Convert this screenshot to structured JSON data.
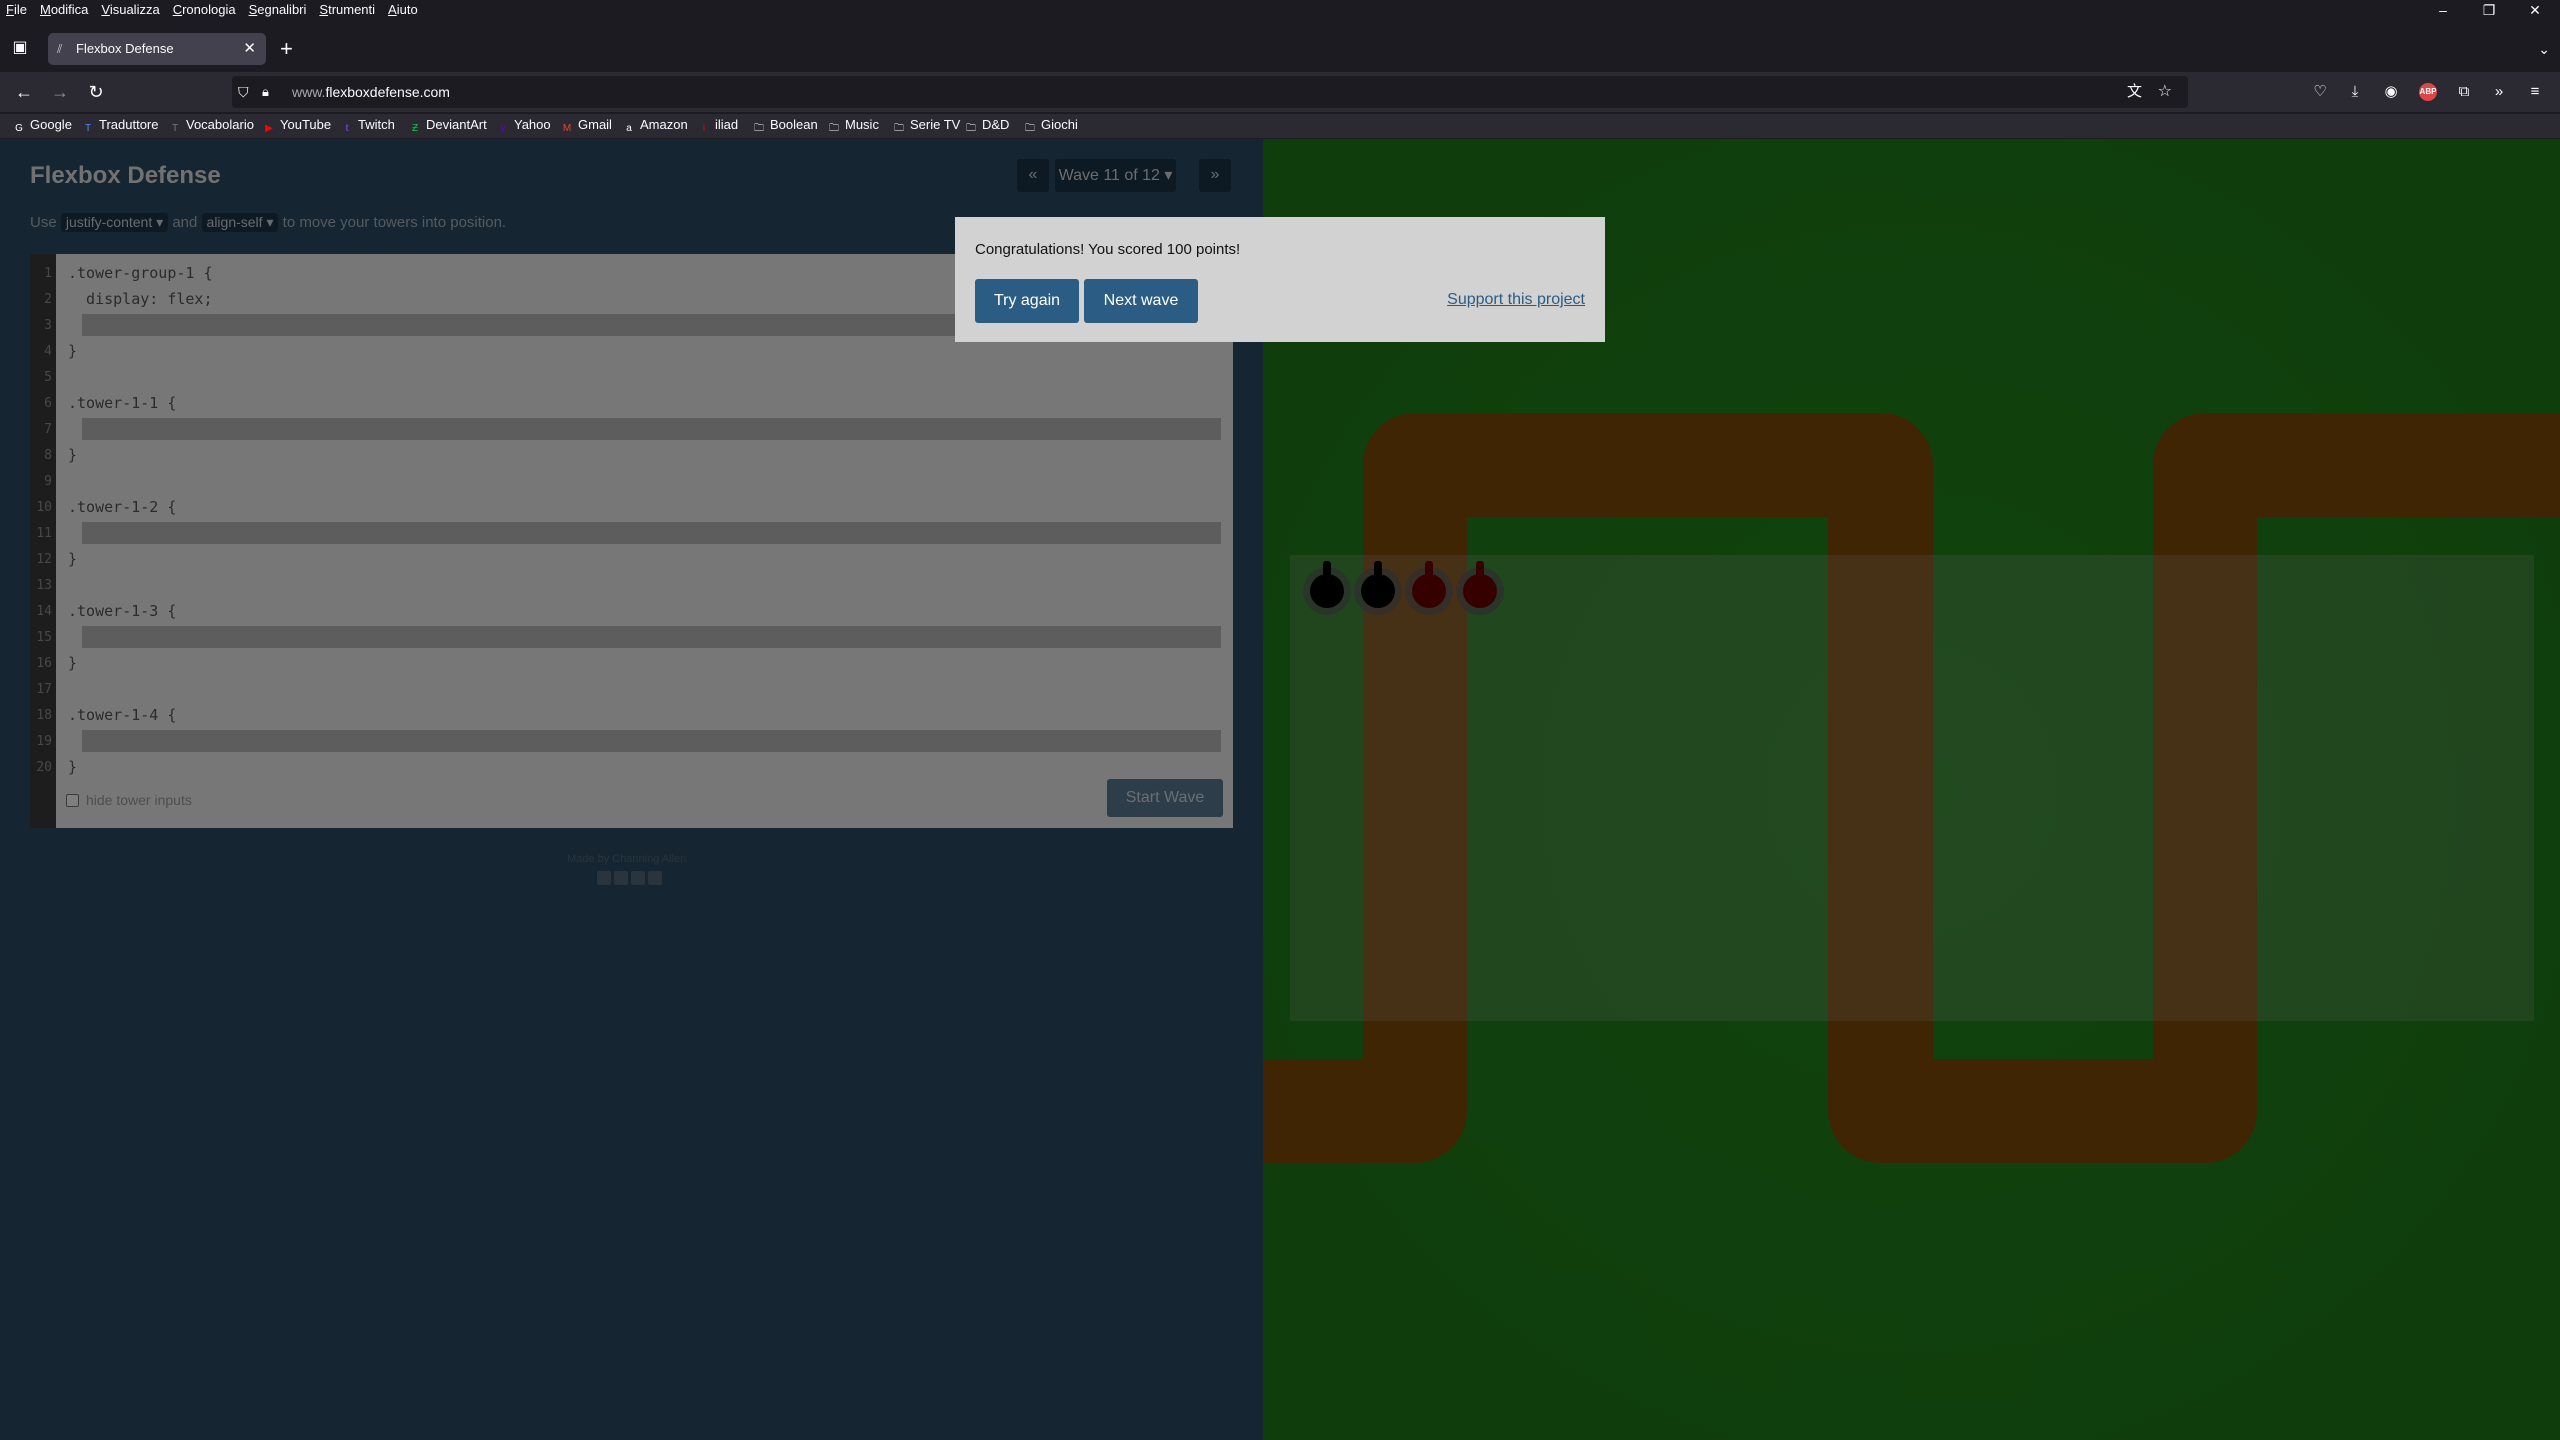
{
  "menubar": {
    "items": [
      "File",
      "Modifica",
      "Visualizza",
      "Cronologia",
      "Segnalibri",
      "Strumenti",
      "Aiuto"
    ]
  },
  "window_controls": {
    "minimize": "–",
    "restore": "❐",
    "close": "✕"
  },
  "tab": {
    "title": "Flexbox Defense",
    "close": "✕",
    "new_tab": "+",
    "list_all": "⌄"
  },
  "navbar": {
    "back": "←",
    "forward": "→",
    "reload": "↻",
    "url_prefix": "www.",
    "url_host": "flexboxdefense.com"
  },
  "bookmarks": [
    {
      "label": "Google",
      "icon": "google-icon",
      "color": "#ffffff"
    },
    {
      "label": "Traduttore",
      "icon": "translate-icon",
      "color": "#4a8af4"
    },
    {
      "label": "Vocabolario",
      "icon": "treccani-icon",
      "color": "#777777"
    },
    {
      "label": "YouTube",
      "icon": "youtube-icon",
      "color": "#ff0000"
    },
    {
      "label": "Twitch",
      "icon": "twitch-icon",
      "color": "#9146ff"
    },
    {
      "label": "DeviantArt",
      "icon": "deviantart-icon",
      "color": "#05cc47"
    },
    {
      "label": "Yahoo",
      "icon": "yahoo-icon",
      "color": "#6001d2"
    },
    {
      "label": "Gmail",
      "icon": "gmail-icon",
      "color": "#ea4335"
    },
    {
      "label": "Amazon",
      "icon": "amazon-icon",
      "color": "#ffffff"
    },
    {
      "label": "iliad",
      "icon": "iliad-icon",
      "color": "#e3051b"
    },
    {
      "label": "Boolean",
      "icon": "folder-icon",
      "color": "#fbfbfe"
    },
    {
      "label": "Music",
      "icon": "folder-icon",
      "color": "#fbfbfe"
    },
    {
      "label": "Serie TV",
      "icon": "folder-icon",
      "color": "#fbfbfe"
    },
    {
      "label": "D&D",
      "icon": "folder-icon",
      "color": "#fbfbfe"
    },
    {
      "label": "Giochi",
      "icon": "folder-icon",
      "color": "#fbfbfe"
    }
  ],
  "game": {
    "title": "Flexbox Defense",
    "wave_label": "Wave 11 of 12 ▾",
    "prev_wave": "«",
    "next_wave": "»",
    "instructions": {
      "use": "Use",
      "kw1": "justify-content ▾",
      "and": "and",
      "kw2": "align-self ▾",
      "rest": "to move your towers into position."
    },
    "code_lines": [
      ".tower-group-1 {",
      "  display: flex;",
      "",
      "}",
      "",
      ".tower-1-1 {",
      "",
      "}",
      "",
      ".tower-1-2 {",
      "",
      "}",
      "",
      ".tower-1-3 {",
      "",
      "}",
      "",
      ".tower-1-4 {",
      "",
      "}"
    ],
    "hide_inputs_label": "hide tower inputs",
    "start_button": "Start Wave",
    "credits": "Made by Channing Allen"
  },
  "modal": {
    "message": "Congratulations! You scored 100 points!",
    "try_again": "Try again",
    "next_wave": "Next wave",
    "support": "Support this project"
  },
  "colors": {
    "grass": "#22861c",
    "path": "#7e4a07",
    "sidebar": "#2b4b62",
    "button": "#2b5d84",
    "tower_black": "#000000",
    "tower_red": "#8b0000"
  },
  "towers": [
    {
      "name": "tower-1-1",
      "color": "black"
    },
    {
      "name": "tower-1-2",
      "color": "black"
    },
    {
      "name": "tower-1-3",
      "color": "red"
    },
    {
      "name": "tower-1-4",
      "color": "red"
    }
  ]
}
